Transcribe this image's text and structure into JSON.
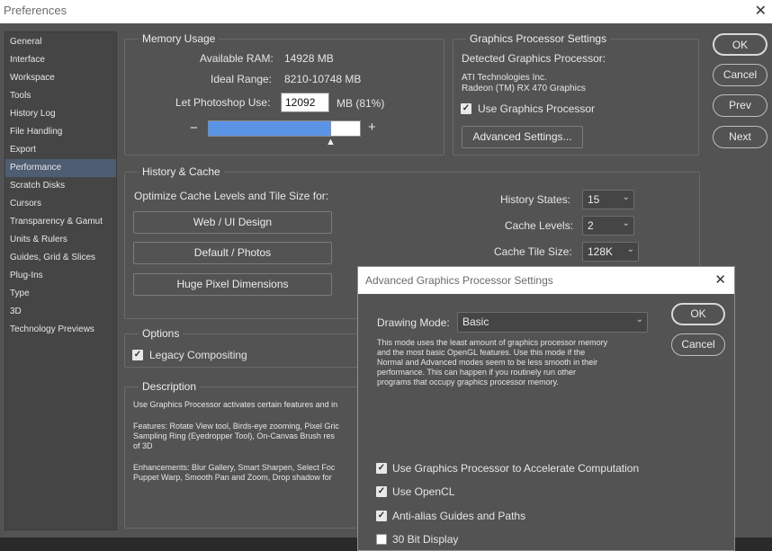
{
  "window": {
    "title": "Preferences",
    "close_glyph": "✕"
  },
  "sidebar": {
    "items": [
      {
        "label": "General"
      },
      {
        "label": "Interface"
      },
      {
        "label": "Workspace"
      },
      {
        "label": "Tools"
      },
      {
        "label": "History Log"
      },
      {
        "label": "File Handling"
      },
      {
        "label": "Export"
      },
      {
        "label": "Performance",
        "selected": true
      },
      {
        "label": "Scratch Disks"
      },
      {
        "label": "Cursors"
      },
      {
        "label": "Transparency & Gamut"
      },
      {
        "label": "Units & Rulers"
      },
      {
        "label": "Guides, Grid & Slices"
      },
      {
        "label": "Plug-Ins"
      },
      {
        "label": "Type"
      },
      {
        "label": "3D"
      },
      {
        "label": "Technology Previews"
      }
    ]
  },
  "memory": {
    "title": "Memory Usage",
    "available_label": "Available RAM:",
    "available_value": "14928 MB",
    "ideal_label": "Ideal Range:",
    "ideal_value": "8210-10748 MB",
    "use_label": "Let Photoshop Use:",
    "use_value": "12092",
    "use_unit": "MB (81%)",
    "minus": "−",
    "plus": "+",
    "slider_fraction": 0.81,
    "marker": "▲"
  },
  "gpu": {
    "title": "Graphics Processor Settings",
    "detected_label": "Detected Graphics Processor:",
    "vendor": "ATI Technologies Inc.",
    "model": "Radeon (TM) RX 470 Graphics",
    "use_label": "Use Graphics Processor",
    "use_checked": true,
    "advanced_button": "Advanced Settings..."
  },
  "actions": {
    "ok": "OK",
    "cancel": "Cancel",
    "prev": "Prev",
    "next": "Next"
  },
  "history": {
    "title": "History & Cache",
    "optimize_label": "Optimize Cache Levels and Tile Size for:",
    "presets": [
      "Web / UI Design",
      "Default / Photos",
      "Huge Pixel Dimensions"
    ],
    "history_states_label": "History States:",
    "history_states_value": "15",
    "cache_levels_label": "Cache Levels:",
    "cache_levels_value": "2",
    "tile_size_label": "Cache Tile Size:",
    "tile_size_value": "128K"
  },
  "options": {
    "title": "Options",
    "legacy_label": "Legacy Compositing",
    "legacy_checked": true
  },
  "description": {
    "title": "Description",
    "para1": "Use Graphics Processor activates certain features and in",
    "para2_lines": [
      "Features: Rotate View tool, Birds-eye zooming, Pixel Gric",
      "Sampling Ring (Eyedropper Tool), On-Canvas Brush res",
      "of 3D"
    ],
    "para3_lines": [
      "Enhancements: Blur Gallery, Smart Sharpen, Select Foc",
      "Puppet Warp, Smooth Pan and Zoom, Drop shadow for"
    ]
  },
  "advanced_dialog": {
    "title": "Advanced Graphics Processor Settings",
    "close_glyph": "✕",
    "drawing_mode_label": "Drawing Mode:",
    "drawing_mode_value": "Basic",
    "mode_description_lines": [
      "This mode uses the least amount of graphics processor memory",
      "and the most basic OpenGL features.  Use this mode if the",
      "Normal and Advanced modes seem to be less smooth in their",
      "performance.  This can happen if you routinely run other",
      "programs that occupy graphics processor memory."
    ],
    "ok": "OK",
    "cancel": "Cancel",
    "checkboxes": [
      {
        "label": "Use Graphics Processor to Accelerate Computation",
        "checked": true
      },
      {
        "label": "Use OpenCL",
        "checked": true
      },
      {
        "label": "Anti-alias Guides and Paths",
        "checked": true
      },
      {
        "label": "30 Bit Display",
        "checked": false
      }
    ]
  },
  "icons": {
    "check": "✓",
    "chevron_down": "⌄"
  }
}
